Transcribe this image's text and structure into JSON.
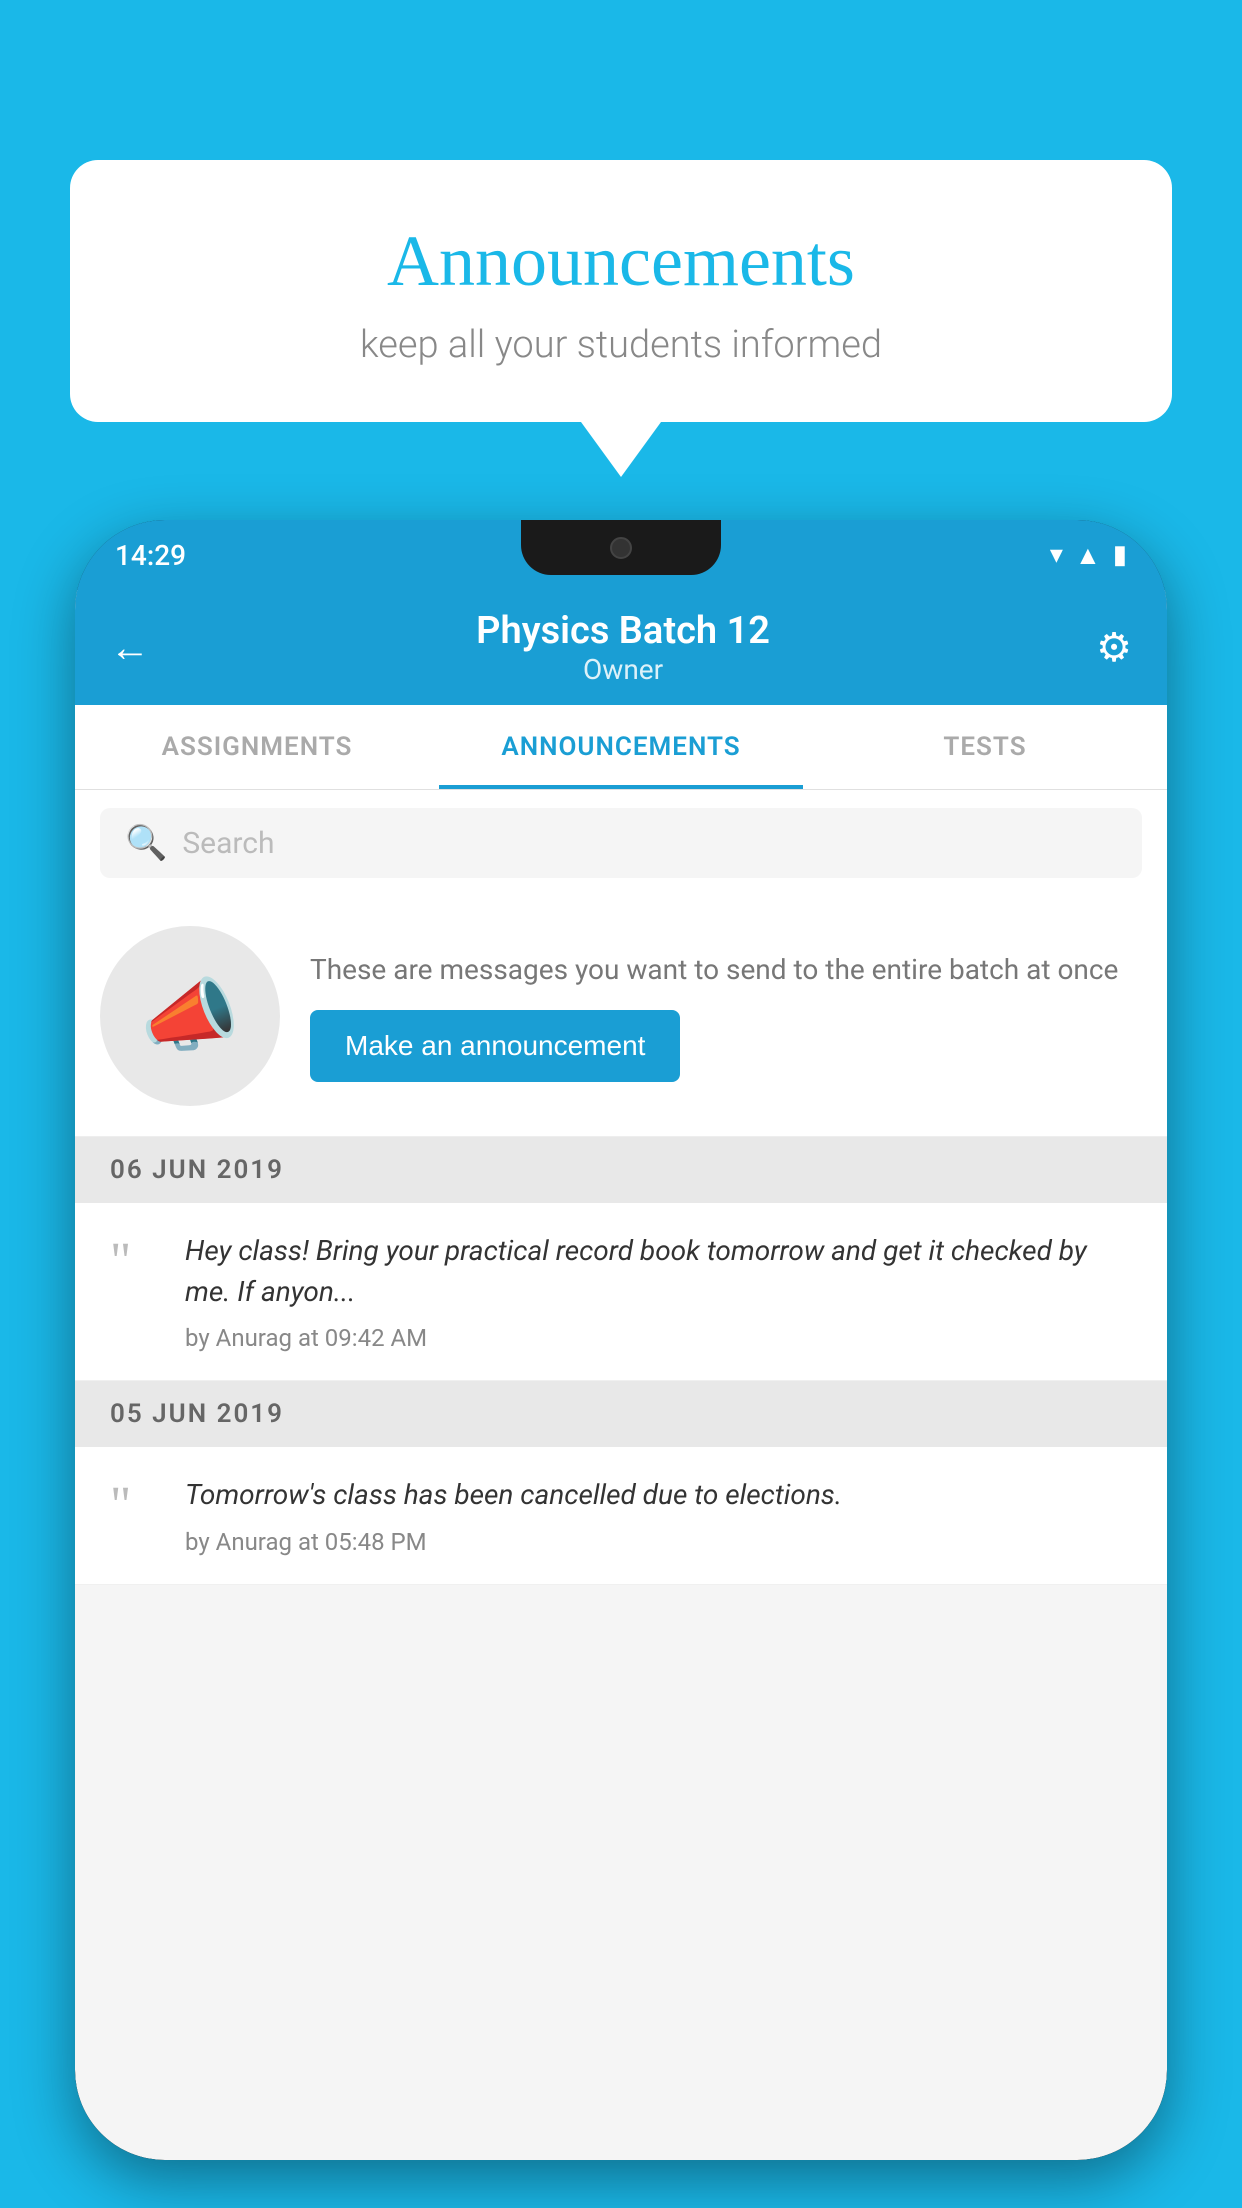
{
  "background_color": "#1ab8e8",
  "speech_bubble": {
    "title": "Announcements",
    "subtitle": "keep all your students informed"
  },
  "phone": {
    "status_bar": {
      "time": "14:29"
    },
    "header": {
      "back_label": "←",
      "title": "Physics Batch 12",
      "subtitle": "Owner",
      "settings_label": "⚙"
    },
    "tabs": [
      {
        "label": "ASSIGNMENTS",
        "active": false
      },
      {
        "label": "ANNOUNCEMENTS",
        "active": true
      },
      {
        "label": "TESTS",
        "active": false
      }
    ],
    "search": {
      "placeholder": "Search"
    },
    "promo": {
      "text": "These are messages you want to send to the entire batch at once",
      "button_label": "Make an announcement"
    },
    "announcements": [
      {
        "date": "06  JUN  2019",
        "text": "Hey class! Bring your practical record book tomorrow and get it checked by me. If anyon...",
        "meta": "by Anurag at 09:42 AM"
      },
      {
        "date": "05  JUN  2019",
        "text": "Tomorrow's class has been cancelled due to elections.",
        "meta": "by Anurag at 05:48 PM"
      }
    ]
  }
}
